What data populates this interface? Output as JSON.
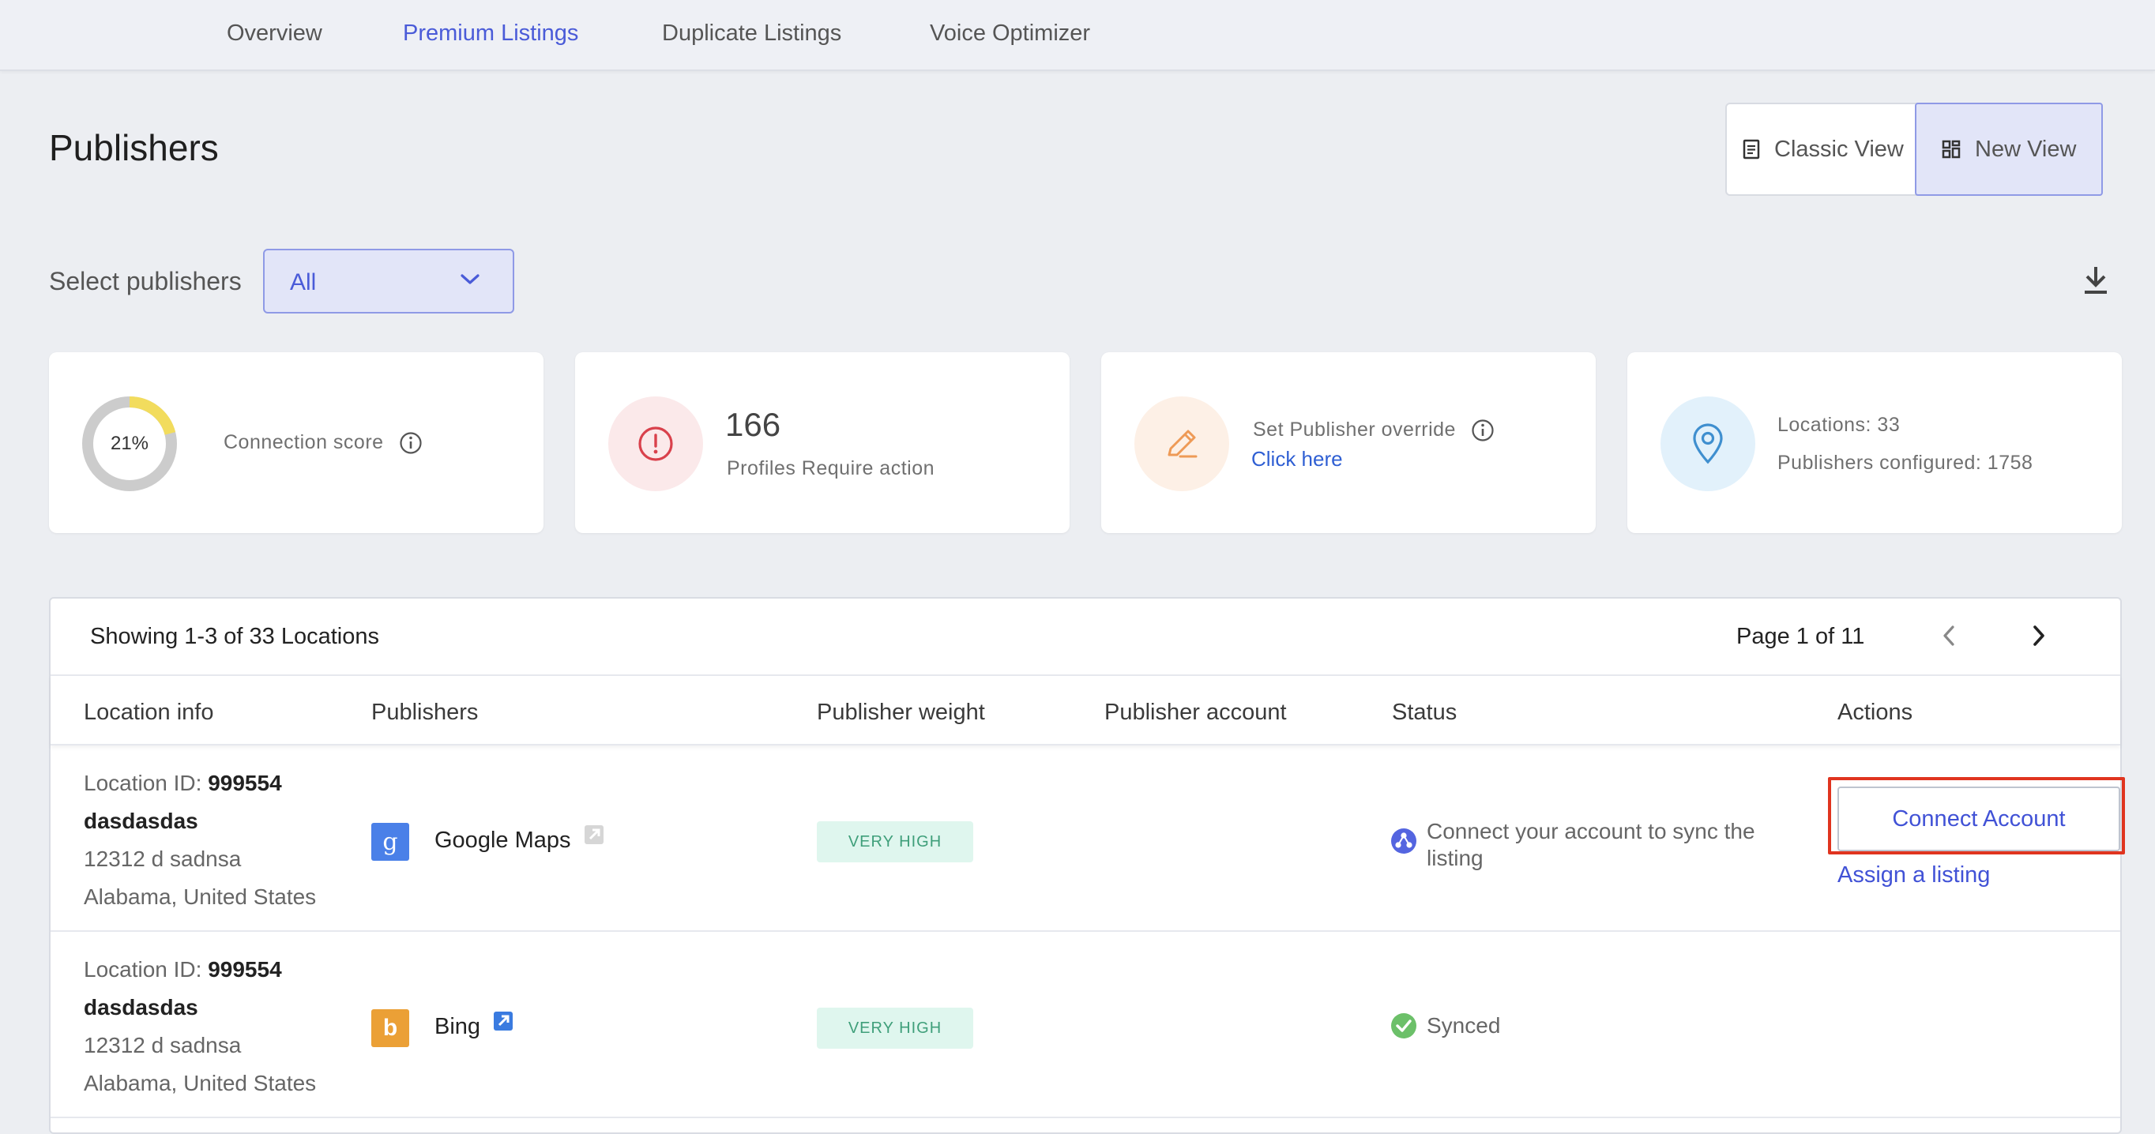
{
  "nav": {
    "tabs": [
      {
        "label": "Overview",
        "active": false
      },
      {
        "label": "Premium Listings",
        "active": true
      },
      {
        "label": "Duplicate Listings",
        "active": false
      },
      {
        "label": "Voice Optimizer",
        "active": false
      }
    ]
  },
  "page": {
    "title": "Publishers"
  },
  "view_toggle": {
    "classic_label": "Classic View",
    "new_label": "New View",
    "selected": "New View"
  },
  "filter": {
    "label": "Select publishers",
    "value": "All"
  },
  "cards": {
    "score": {
      "value": "21%",
      "fraction": 0.21,
      "label": "Connection score"
    },
    "action": {
      "count": "166",
      "label": "Profiles Require action"
    },
    "override": {
      "label": "Set Publisher override",
      "link": "Click here"
    },
    "locations": {
      "locations_text": "Locations: 33",
      "configured_text": "Publishers configured: 1758"
    }
  },
  "table": {
    "showing": "Showing 1-3 of 33 Locations",
    "page_info": "Page 1 of 11",
    "columns": [
      "Location info",
      "Publishers",
      "Publisher weight",
      "Publisher account",
      "Status",
      "Actions"
    ],
    "rows": [
      {
        "location_id_label": "Location ID: ",
        "location_id": "999554",
        "name": "dasdasdas",
        "address": "12312 d sadnsa",
        "region": "Alabama, United States",
        "publisher": "Google Maps",
        "publisher_icon": "google-g-logo",
        "weight": "VERY HIGH",
        "account": "",
        "status": "Connect your account to sync the listing",
        "status_line1": "Connect your account to sync the",
        "status_line2": "listing",
        "status_icon": "connect-sync-icon",
        "action_primary": "Connect Account",
        "action_secondary": "Assign a listing"
      },
      {
        "location_id_label": "Location ID: ",
        "location_id": "999554",
        "name": "dasdasdas",
        "address": "12312 d sadnsa",
        "region": "Alabama, United States",
        "publisher": "Bing",
        "publisher_icon": "bing-logo",
        "weight": "VERY HIGH",
        "account": "",
        "status": "Synced",
        "status_icon": "check-circle-icon"
      }
    ]
  },
  "colors": {
    "accent": "#4a5bd8",
    "highlight": "#e0341f",
    "synced": "#6cc069",
    "weight_bg": "#dff6ee",
    "weight_text": "#3f9f7a"
  }
}
